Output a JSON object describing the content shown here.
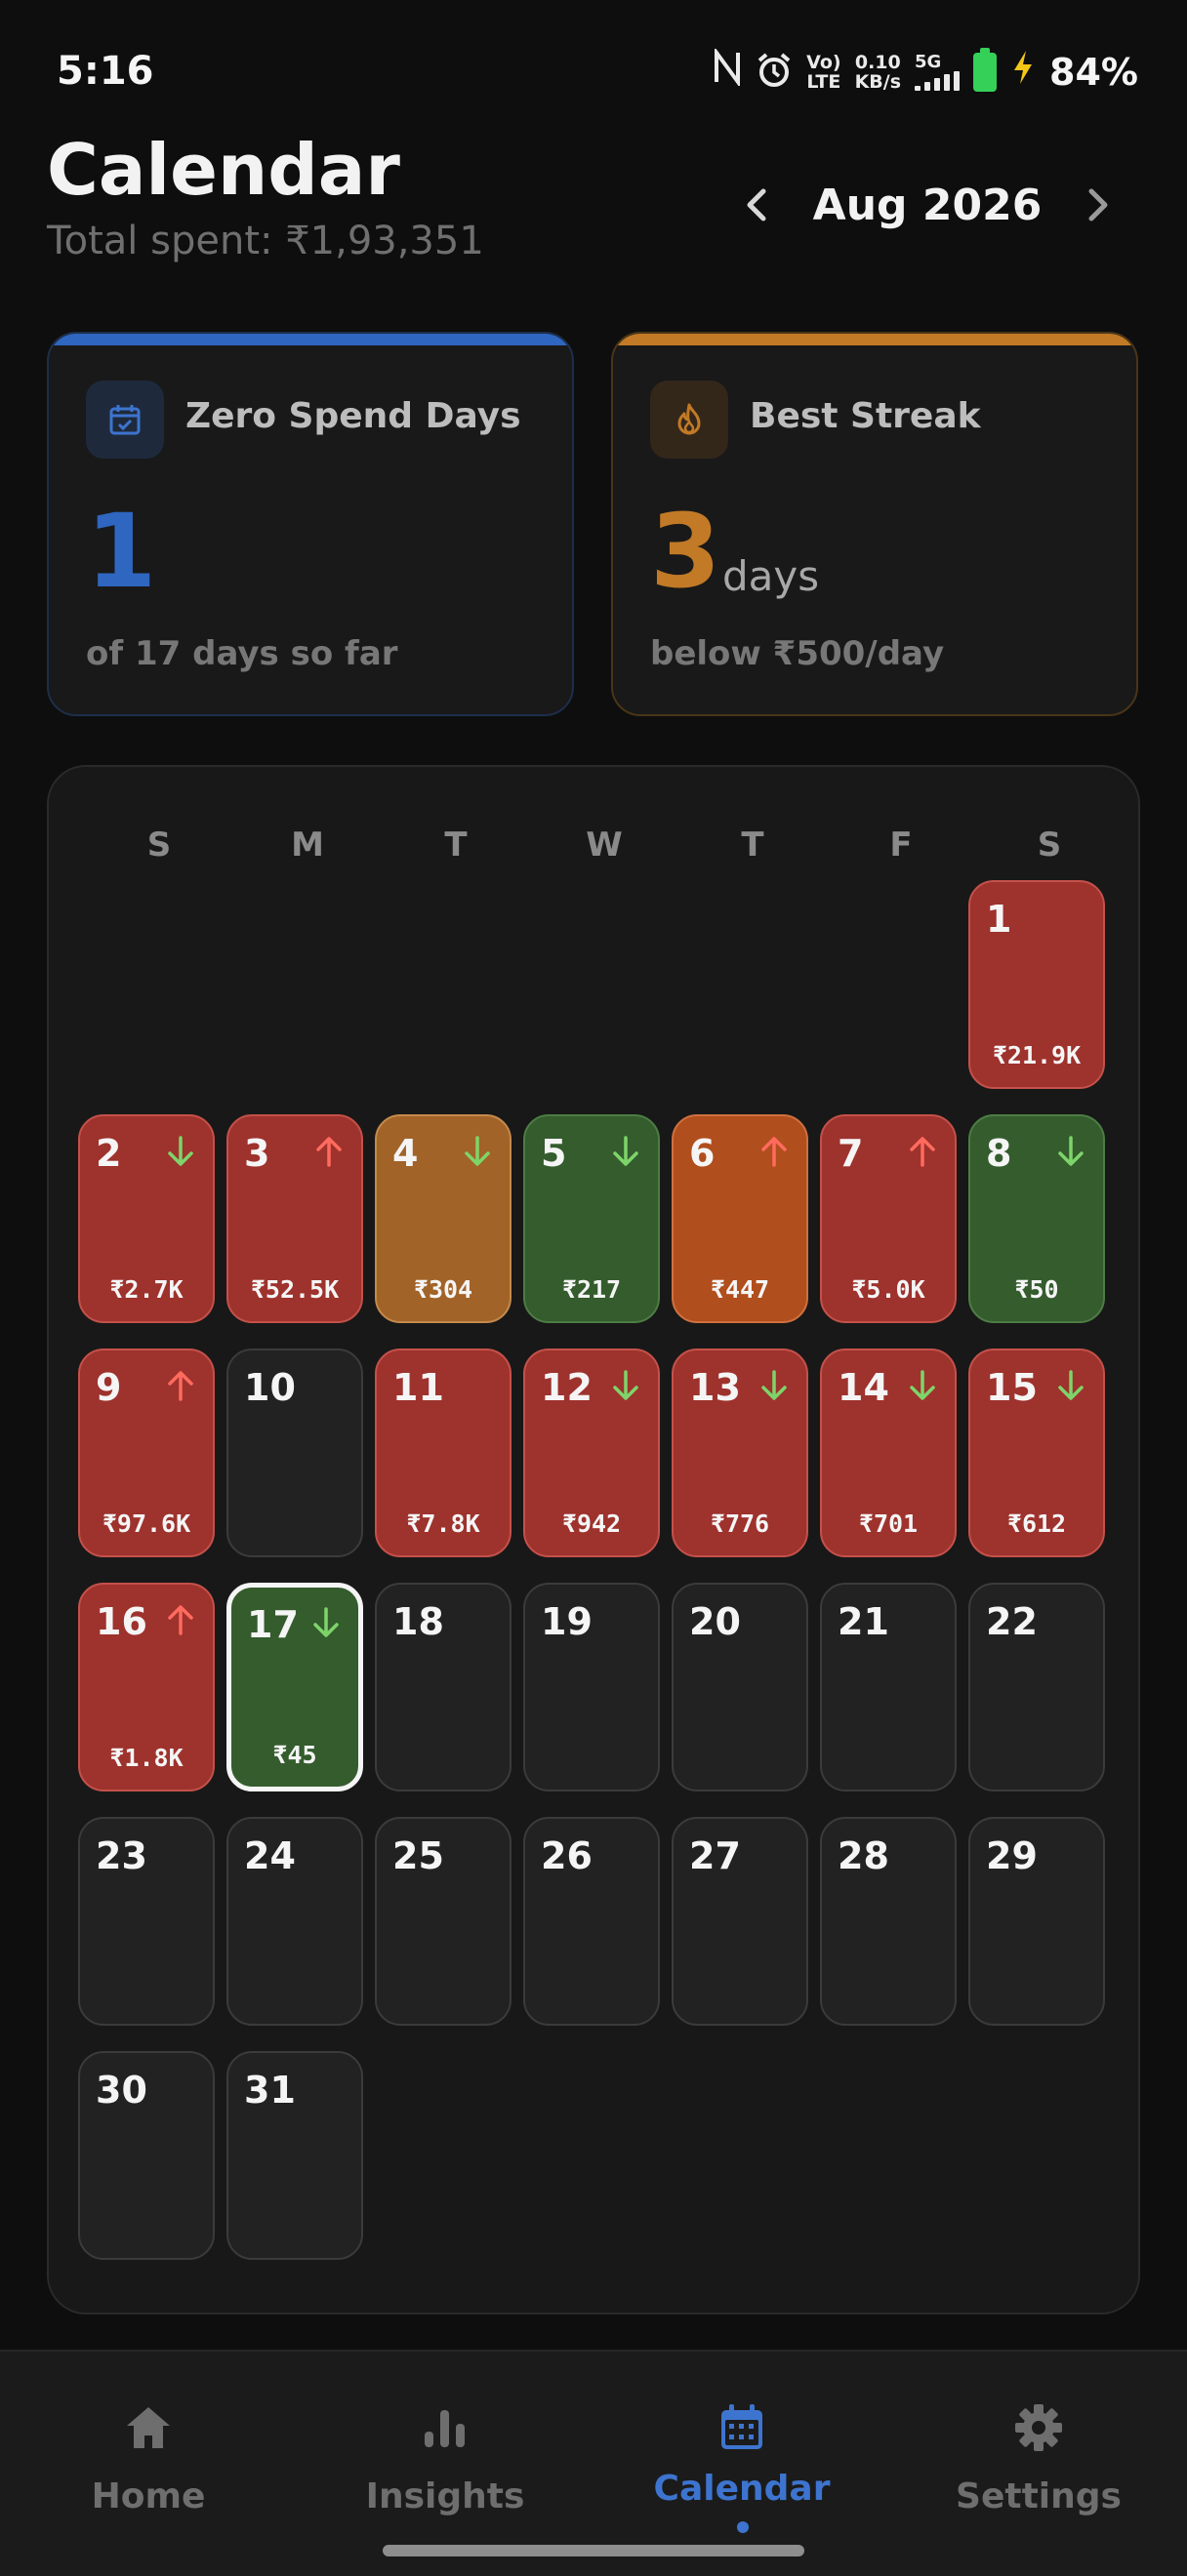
{
  "status_bar": {
    "time": "5:16",
    "data_rate_value": "0.10",
    "data_rate_unit": "KB/s",
    "volte_top": "Vo)",
    "volte_bottom": "LTE",
    "network": "5G",
    "battery": "84%"
  },
  "header": {
    "title": "Calendar",
    "total_spent": "Total spent: ₹1,93,351",
    "month": "Aug 2026"
  },
  "cards": {
    "zero_spend": {
      "title": "Zero Spend Days",
      "value": "1",
      "footnote": "of 17 days so far"
    },
    "best_streak": {
      "title": "Best Streak",
      "value": "3",
      "unit": "days",
      "footnote": "below ₹500/day"
    }
  },
  "calendar": {
    "weekdays": [
      "S",
      "M",
      "T",
      "W",
      "T",
      "F",
      "S"
    ],
    "days": [
      {
        "day": "1",
        "amount": "₹21.9K",
        "tone": "red",
        "trend": ""
      },
      {
        "day": "2",
        "amount": "₹2.7K",
        "tone": "red",
        "trend": "down"
      },
      {
        "day": "3",
        "amount": "₹52.5K",
        "tone": "red",
        "trend": "up"
      },
      {
        "day": "4",
        "amount": "₹304",
        "tone": "amber",
        "trend": "down"
      },
      {
        "day": "5",
        "amount": "₹217",
        "tone": "green",
        "trend": "down"
      },
      {
        "day": "6",
        "amount": "₹447",
        "tone": "burnt",
        "trend": "up"
      },
      {
        "day": "7",
        "amount": "₹5.0K",
        "tone": "red",
        "trend": "up"
      },
      {
        "day": "8",
        "amount": "₹50",
        "tone": "green",
        "trend": "down"
      },
      {
        "day": "9",
        "amount": "₹97.6K",
        "tone": "red",
        "trend": "up"
      },
      {
        "day": "10",
        "amount": "",
        "tone": "empty",
        "trend": ""
      },
      {
        "day": "11",
        "amount": "₹7.8K",
        "tone": "red",
        "trend": ""
      },
      {
        "day": "12",
        "amount": "₹942",
        "tone": "red",
        "trend": "down"
      },
      {
        "day": "13",
        "amount": "₹776",
        "tone": "red",
        "trend": "down"
      },
      {
        "day": "14",
        "amount": "₹701",
        "tone": "red",
        "trend": "down"
      },
      {
        "day": "15",
        "amount": "₹612",
        "tone": "red",
        "trend": "down"
      },
      {
        "day": "16",
        "amount": "₹1.8K",
        "tone": "red",
        "trend": "up"
      },
      {
        "day": "17",
        "amount": "₹45",
        "tone": "green",
        "trend": "down",
        "today": true
      },
      {
        "day": "18",
        "amount": "",
        "tone": "empty",
        "trend": ""
      },
      {
        "day": "19",
        "amount": "",
        "tone": "empty",
        "trend": ""
      },
      {
        "day": "20",
        "amount": "",
        "tone": "empty",
        "trend": ""
      },
      {
        "day": "21",
        "amount": "",
        "tone": "empty",
        "trend": ""
      },
      {
        "day": "22",
        "amount": "",
        "tone": "empty",
        "trend": ""
      },
      {
        "day": "23",
        "amount": "",
        "tone": "empty",
        "trend": ""
      },
      {
        "day": "24",
        "amount": "",
        "tone": "empty",
        "trend": ""
      },
      {
        "day": "25",
        "amount": "",
        "tone": "empty",
        "trend": ""
      },
      {
        "day": "26",
        "amount": "",
        "tone": "empty",
        "trend": ""
      },
      {
        "day": "27",
        "amount": "",
        "tone": "empty",
        "trend": ""
      },
      {
        "day": "28",
        "amount": "",
        "tone": "empty",
        "trend": ""
      },
      {
        "day": "29",
        "amount": "",
        "tone": "empty",
        "trend": ""
      },
      {
        "day": "30",
        "amount": "",
        "tone": "empty",
        "trend": ""
      },
      {
        "day": "31",
        "amount": "",
        "tone": "empty",
        "trend": ""
      }
    ]
  },
  "bottom_nav": {
    "items": [
      {
        "label": "Home",
        "icon": "home-icon"
      },
      {
        "label": "Insights",
        "icon": "bar-chart-icon"
      },
      {
        "label": "Calendar",
        "icon": "calendar-icon",
        "active": true
      },
      {
        "label": "Settings",
        "icon": "gear-icon"
      }
    ]
  },
  "colors": {
    "accent": "#3d74cf",
    "card_blue": "#2f66c0",
    "card_orange": "#c27a26",
    "over_budget": "#9e322d",
    "under_budget": "#345c2d",
    "trend_up": "#ff6b5e",
    "trend_down": "#7ed46a"
  }
}
